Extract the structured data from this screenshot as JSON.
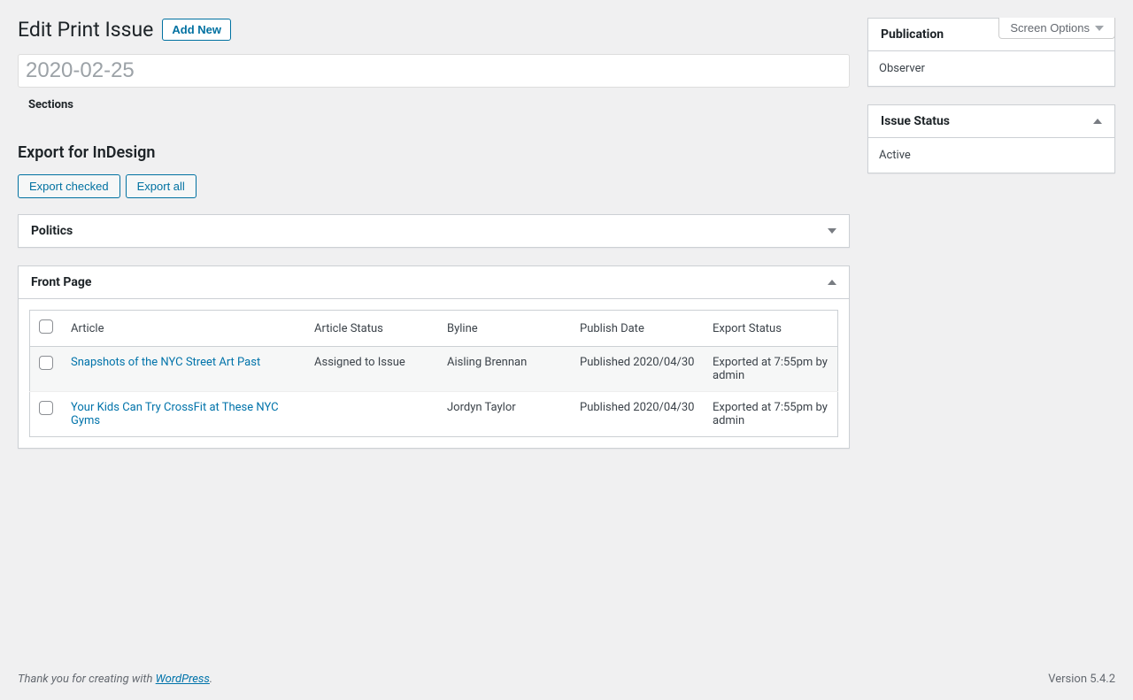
{
  "screen_options_label": "Screen Options",
  "page_title": "Edit Print Issue",
  "add_new_label": "Add New",
  "title_value": "2020-02-25",
  "sections_label": "Sections",
  "export_heading": "Export for InDesign",
  "export_checked_label": "Export checked",
  "export_all_label": "Export all",
  "politics_section_title": "Politics",
  "frontpage_section_title": "Front Page",
  "table": {
    "headers": {
      "article": "Article",
      "status": "Article Status",
      "byline": "Byline",
      "date": "Publish Date",
      "export": "Export Status"
    },
    "rows": [
      {
        "title": "Snapshots of the NYC Street Art Past",
        "status": "Assigned to Issue",
        "byline": "Aisling Brennan",
        "date": "Published 2020/04/30",
        "export": "Exported at 7:55pm by admin"
      },
      {
        "title": "Your Kids Can Try CrossFit at These NYC Gyms",
        "status": "",
        "byline": "Jordyn Taylor",
        "date": "Published 2020/04/30",
        "export": "Exported at 7:55pm by admin"
      }
    ]
  },
  "sidebar": {
    "publication": {
      "title": "Publication",
      "value": "Observer"
    },
    "status": {
      "title": "Issue Status",
      "value": "Active"
    }
  },
  "footer": {
    "thanks_prefix": "Thank you for creating with ",
    "link_text": "WordPress",
    "period": ".",
    "version": "Version 5.4.2"
  }
}
